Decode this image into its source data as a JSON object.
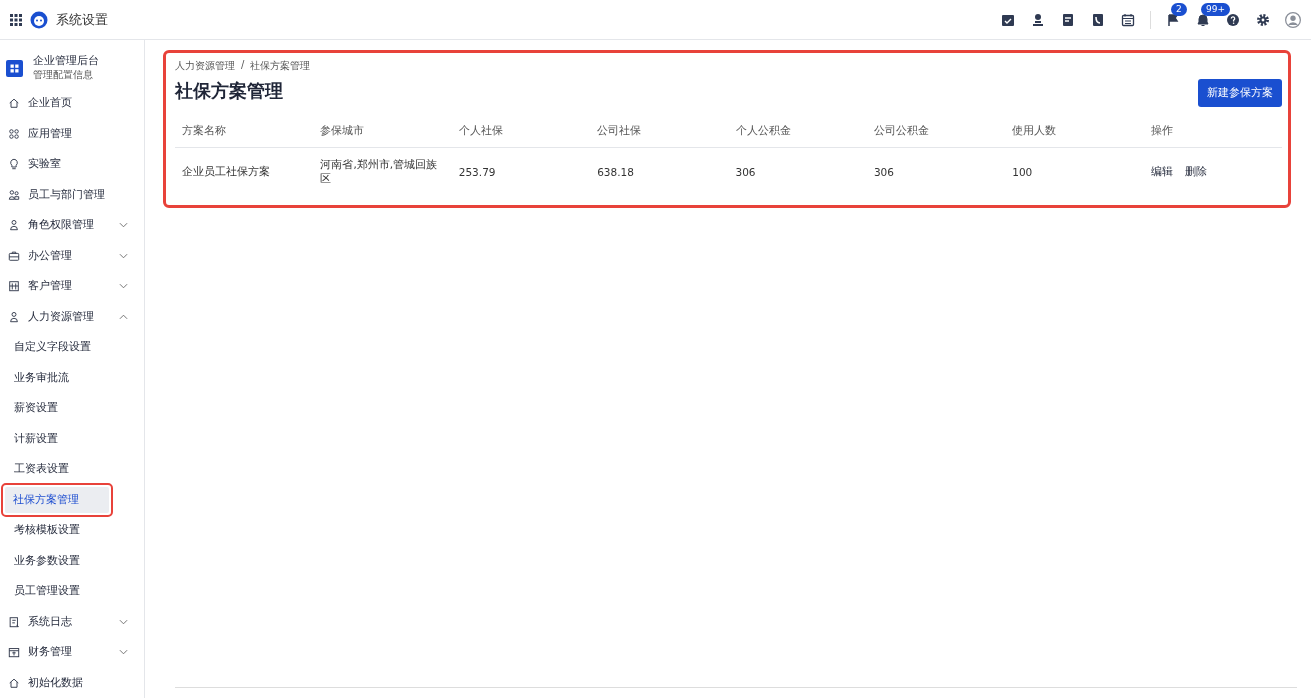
{
  "app": {
    "title": "系统设置"
  },
  "toolbar": {
    "badges": [
      {
        "kind": "flag",
        "count": "2"
      },
      {
        "kind": "bell",
        "count": "99+"
      }
    ]
  },
  "sidebar": {
    "title": "企业管理后台",
    "subtitle": "管理配置信息",
    "items": [
      {
        "label": "企业首页",
        "kind": "home"
      },
      {
        "label": "应用管理",
        "kind": "apps"
      },
      {
        "label": "实验室",
        "kind": "bulb"
      },
      {
        "label": "员工与部门管理",
        "kind": "people"
      },
      {
        "label": "角色权限管理",
        "kind": "person",
        "expanded": false
      },
      {
        "label": "办公管理",
        "kind": "case",
        "expanded": false
      },
      {
        "label": "客户管理",
        "kind": "building",
        "expanded": false
      },
      {
        "label": "人力资源管理",
        "kind": "person",
        "expanded": true,
        "children": [
          {
            "label": "自定义字段设置",
            "selected": false
          },
          {
            "label": "业务审批流",
            "selected": false
          },
          {
            "label": "薪资设置",
            "selected": false
          },
          {
            "label": "计薪设置",
            "selected": false
          },
          {
            "label": "工资表设置",
            "selected": false
          },
          {
            "label": "社保方案管理",
            "selected": true
          },
          {
            "label": "考核模板设置",
            "selected": false
          },
          {
            "label": "业务参数设置",
            "selected": false
          },
          {
            "label": "员工管理设置",
            "selected": false
          }
        ]
      },
      {
        "label": "系统日志",
        "kind": "log",
        "expanded": false
      },
      {
        "label": "财务管理",
        "kind": "money",
        "expanded": false
      },
      {
        "label": "初始化数据",
        "kind": "home"
      }
    ]
  },
  "breadcrumb": {
    "items": [
      "人力资源管理",
      "社保方案管理"
    ],
    "separator": "/"
  },
  "page_title": "社保方案管理",
  "new_button": "新建参保方案",
  "table": {
    "columns": [
      "方案名称",
      "参保城市",
      "个人社保",
      "公司社保",
      "个人公积金",
      "公司公积金",
      "使用人数",
      "操作"
    ],
    "rows": [
      {
        "cells": [
          "企业员工社保方案",
          "河南省,郑州市,管城回族区",
          "253.79",
          "638.18",
          "306",
          "306",
          "100"
        ],
        "actions": [
          "编辑",
          "删除"
        ]
      }
    ]
  }
}
